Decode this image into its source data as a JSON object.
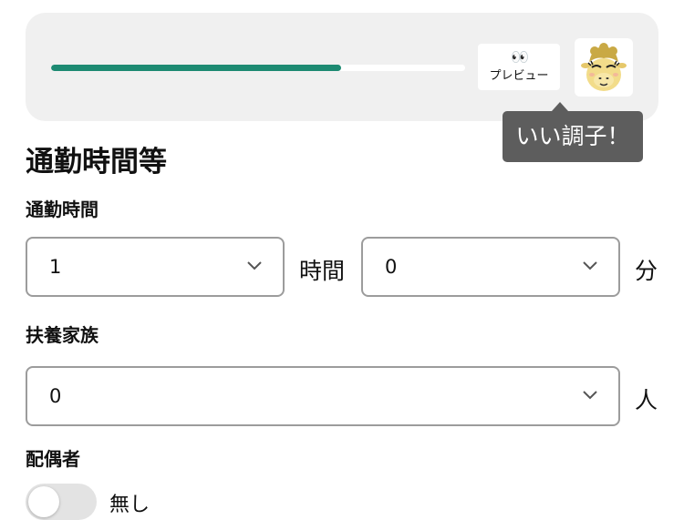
{
  "header": {
    "progress_percent": 70,
    "preview_button": {
      "eyes": "👀",
      "label": "プレビュー"
    },
    "avatar_icon": "camel-mascot-icon",
    "tooltip": "いい調子！"
  },
  "section": {
    "title": "通勤時間等",
    "commute": {
      "label": "通勤時間",
      "hours_value": "1",
      "hours_unit": "時間",
      "minutes_value": "0",
      "minutes_unit": "分"
    },
    "dependents": {
      "label": "扶養家族",
      "value": "0",
      "unit": "人"
    },
    "spouse": {
      "label": "配偶者",
      "toggle_label": "無し",
      "enabled": false
    }
  },
  "colors": {
    "accent": "#1d8a72",
    "card_bg": "#f0f0f0",
    "tooltip_bg": "#5d5d5d"
  }
}
